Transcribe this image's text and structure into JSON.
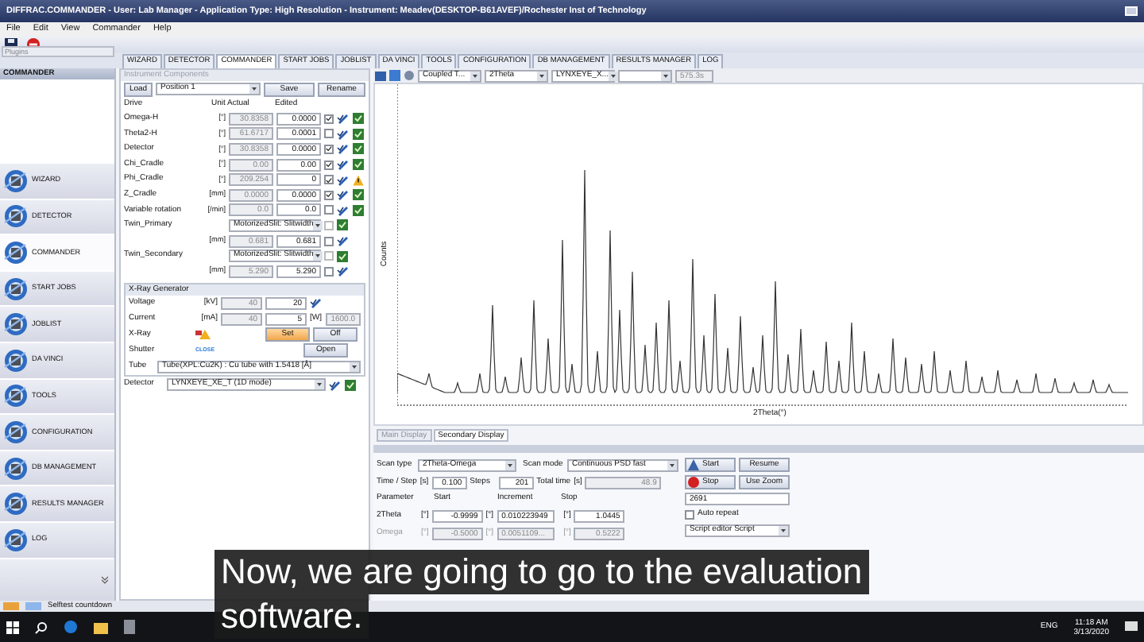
{
  "window": {
    "title": "DIFFRAC.COMMANDER - User: Lab Manager - Application Type: High Resolution - Instrument: Meadev(DESKTOP-B61AVEF)/Rochester Inst of Technology"
  },
  "menu": [
    "File",
    "Edit",
    "View",
    "Commander",
    "Help"
  ],
  "plugins": {
    "placeholder": "Plugins"
  },
  "tabs": [
    {
      "label": "WIZARD",
      "selected": false
    },
    {
      "label": "DETECTOR",
      "selected": false
    },
    {
      "label": "COMMANDER",
      "selected": true
    },
    {
      "label": "START JOBS",
      "selected": false
    },
    {
      "label": "JOBLIST",
      "selected": false
    },
    {
      "label": "DA VINCI",
      "selected": false
    },
    {
      "label": "TOOLS",
      "selected": false
    },
    {
      "label": "CONFIGURATION",
      "selected": false
    },
    {
      "label": "DB MANAGEMENT",
      "selected": false
    },
    {
      "label": "RESULTS MANAGER",
      "selected": false
    },
    {
      "label": "LOG",
      "selected": false
    }
  ],
  "sidebar": {
    "title": "COMMANDER",
    "items": [
      {
        "label": "WIZARD",
        "selected": false
      },
      {
        "label": "DETECTOR",
        "selected": false
      },
      {
        "label": "COMMANDER",
        "selected": true
      },
      {
        "label": "START JOBS",
        "selected": false
      },
      {
        "label": "JOBLIST",
        "selected": false
      },
      {
        "label": "DA VINCI",
        "selected": false
      },
      {
        "label": "TOOLS",
        "selected": false
      },
      {
        "label": "CONFIGURATION",
        "selected": false
      },
      {
        "label": "DB MANAGEMENT",
        "selected": false
      },
      {
        "label": "RESULTS MANAGER",
        "selected": false
      },
      {
        "label": "LOG",
        "selected": false
      }
    ]
  },
  "components": {
    "title": "Instrument Components",
    "load": "Load",
    "position": "Position 1",
    "save": "Save",
    "rename": "Rename",
    "headers": [
      "Drive",
      "Unit Actual",
      "Edited"
    ],
    "drives": [
      {
        "kind": "value",
        "name": "Omega-H",
        "unit": "[°]",
        "actual": "30.8358",
        "edited": "0.0000",
        "checked": true,
        "warning": false
      },
      {
        "kind": "value",
        "name": "Theta2-H",
        "unit": "[°]",
        "actual": "61.6717",
        "edited": "0.0001",
        "checked": false,
        "warning": false
      },
      {
        "kind": "value",
        "name": "Detector",
        "unit": "[°]",
        "actual": "30.8358",
        "edited": "0.0000",
        "checked": true,
        "warning": false
      },
      {
        "kind": "value",
        "name": "Chi_Cradle",
        "unit": "[°]",
        "actual": "0.00",
        "edited": "0.00",
        "checked": true,
        "warning": false
      },
      {
        "kind": "value",
        "name": "Phi_Cradle",
        "unit": "[°]",
        "actual": "209.254",
        "edited": "0",
        "checked": true,
        "warning": true
      },
      {
        "kind": "value",
        "name": "Z_Cradle",
        "unit": "[mm]",
        "actual": "0.0000",
        "edited": "0.0000",
        "checked": true,
        "warning": false
      },
      {
        "kind": "value",
        "name": "Variable rotation",
        "unit": "[/min]",
        "actual": "0.0",
        "edited": "0.0",
        "checked": false,
        "warning": false
      },
      {
        "kind": "slit",
        "name": "Twin_Primary",
        "mode": "MotorizedSlit: Slitwidth",
        "unit": "[mm]",
        "actual": "0.681",
        "edited": "0.681",
        "checked": false,
        "warning": false
      },
      {
        "kind": "slit",
        "name": "Twin_Secondary",
        "mode": "MotorizedSlit: Slitwidth",
        "unit": "[mm]",
        "actual": "5.290",
        "edited": "5.290",
        "checked": false,
        "warning": false
      }
    ]
  },
  "xray": {
    "title": "X-Ray Generator",
    "rows": [
      {
        "label": "Voltage",
        "unit": "[kV]",
        "actual": "40",
        "set": "20"
      },
      {
        "label": "Current",
        "unit": "[mA]",
        "actual": "40",
        "set": "5",
        "power_unit": "[W]",
        "power": "1600.0"
      }
    ],
    "xray_label": "X-Ray",
    "set_button": "Set",
    "off_button": "Off",
    "shutter_label": "Shutter",
    "shutter_state": "CLOSE",
    "open_button": "Open",
    "tube_label": "Tube",
    "tube": "Tube(XPL:Cu2K) : Cu tube with 1.5418 [Å]"
  },
  "detector": {
    "label": "Detector",
    "value": "LYNXEYE_XE_T (1D mode)"
  },
  "plot_toolbar": {
    "dropdowns": [
      "Coupled T...",
      "2Theta",
      "LYNXEYE_X..."
    ],
    "time": "575.3s"
  },
  "plot": {
    "ylabel": "Counts",
    "xlabel": "2Theta(°)"
  },
  "display_tabs": [
    {
      "label": "Main Display",
      "selected": false
    },
    {
      "label": "Secondary Display",
      "selected": true
    }
  ],
  "scan": {
    "scan_type_label": "Scan type",
    "scan_type": "2Theta-Omega",
    "scan_mode_label": "Scan mode",
    "scan_mode": "Continuous PSD fast",
    "time_step_label": "Time / Step",
    "time_step_unit": "[s]",
    "time_step": "0.100",
    "steps_label": "Steps",
    "steps": "201",
    "total_time_label": "Total time",
    "total_time_unit": "[s]",
    "total_time": "48.9",
    "start": "Start",
    "resume": "Resume",
    "stop": "Stop",
    "use_zoom": "Use Zoom",
    "counter": "2691",
    "auto_repeat": {
      "label": "Auto repeat",
      "checked": false
    },
    "script": "Script editor Script",
    "columns": [
      "Parameter",
      "Start",
      "Increment",
      "Stop"
    ],
    "params": [
      {
        "name": "2Theta",
        "unit": "[°]",
        "start": "-0.9999",
        "increment": "0.010223949",
        "stop": "1.0445",
        "disabled": false
      },
      {
        "name": "Omega",
        "unit": "[°]",
        "start": "-0.5000",
        "increment": "0.0051109...",
        "stop": "0.5222",
        "disabled": true
      }
    ]
  },
  "status_bar": {
    "selftest": "Selftest countdown"
  },
  "taskbar": {
    "language": "ENG",
    "time": "11:18 AM",
    "date": "3/13/2020"
  },
  "caption": [
    "Now, we are going to go to the evaluation",
    "software."
  ]
}
